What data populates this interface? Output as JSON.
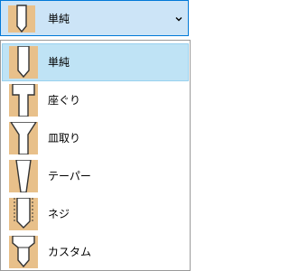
{
  "combo": {
    "selected_label": "単純",
    "selected_icon": "simple-hole-icon",
    "dropdown_icon": "chevron-down-icon"
  },
  "options": [
    {
      "label": "単純",
      "icon": "simple-hole-icon",
      "selected": true
    },
    {
      "label": "座ぐり",
      "icon": "counterbore-hole-icon",
      "selected": false
    },
    {
      "label": "皿取り",
      "icon": "countersink-hole-icon",
      "selected": false
    },
    {
      "label": "テーパー",
      "icon": "tapered-hole-icon",
      "selected": false
    },
    {
      "label": "ネジ",
      "icon": "threaded-hole-icon",
      "selected": false
    },
    {
      "label": "カスタム",
      "icon": "custom-hole-icon",
      "selected": false
    }
  ],
  "colors": {
    "wood": "#e8c08a",
    "hole_fill": "#ffffff",
    "outline": "#333333",
    "selection": "#bfe3f5",
    "focus_border": "#0078d7"
  }
}
